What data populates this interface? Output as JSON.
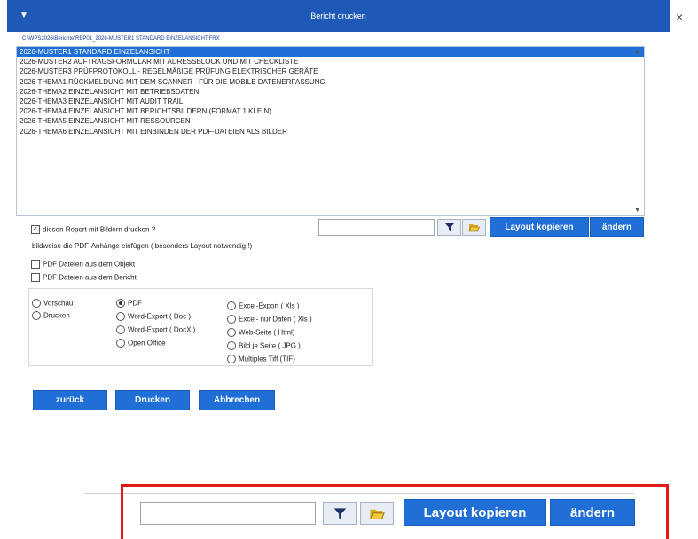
{
  "window": {
    "title": "Bericht drucken",
    "menu_icon": "filter-icon",
    "close_label": "×"
  },
  "path": "C:\\WPS2026\\Berichte\\REP01_2026-MUSTER1 STANDARD EINZELANSICHT.FRX",
  "reports": [
    {
      "label": "2026-MUSTER1 STANDARD EINZELANSICHT",
      "selected": true
    },
    {
      "label": "2026-MUSTER2 AUFTRAGSFORMULAR MIT ADRESSBLOCK UND MIT CHECKLISTE",
      "selected": false
    },
    {
      "label": "2026-MUSTER3 PRÜFPROTOKOLL - REGELMÄßIGE PRÜFUNG ELEKTRISCHER GERÄTE",
      "selected": false
    },
    {
      "label": "2026-THEMA1 RÜCKMELDUNG MIT DEM SCANNER - FÜR DIE MOBILE DATENERFASSUNG",
      "selected": false
    },
    {
      "label": "2026-THEMA2 EINZELANSICHT MIT BETRIEBSDATEN",
      "selected": false
    },
    {
      "label": "2026-THEMA3 EINZELANSICHT MIT AUDIT TRAIL",
      "selected": false
    },
    {
      "label": "2026-THEMA4 EINZELANSICHT MIT BERICHTSBILDERN (FORMAT 1 KLEIN)",
      "selected": false
    },
    {
      "label": "2026-THEMA5 EINZELANSICHT MIT RESSOURCEN",
      "selected": false
    },
    {
      "label": "2026-THEMA6 EINZELANSICHT MIT EINBINDEN DER PDF-DATEIEN ALS BILDER",
      "selected": false
    }
  ],
  "print_with_images": {
    "label": "diesen Report mit Bildern drucken ?",
    "checked": true
  },
  "toolbar": {
    "search_value": "",
    "filter_icon": "filter-icon",
    "folder_icon": "folder-open-icon",
    "copy_layout_label": "Layout kopieren",
    "change_label": "ändern"
  },
  "pdf_attach": {
    "hint": "bildweise die PDF-Anhänge einfügen ( besonders Layout notwendig !)",
    "from_object": {
      "label": "PDF Dateien aus dem Objekt",
      "checked": false
    },
    "from_report": {
      "label": "PDF Dateien aus dem Bericht",
      "checked": false
    }
  },
  "output_target": [
    {
      "label": "Vorschau",
      "selected": false
    },
    {
      "label": "Drucken",
      "selected": false
    }
  ],
  "formats_col1": [
    {
      "label": "PDF",
      "selected": true
    },
    {
      "label": "Word-Export ( Doc )",
      "selected": false
    },
    {
      "label": "Word-Export  ( DocX )",
      "selected": false
    },
    {
      "label": "Open Office",
      "selected": false
    }
  ],
  "formats_col2": [
    {
      "label": "Excel-Export ( Xls )",
      "selected": false
    },
    {
      "label": "Excel- nur Daten ( Xls )",
      "selected": false
    },
    {
      "label": "Web-Seite ( Html)",
      "selected": false
    },
    {
      "label": "Bild je Seite ( JPG )",
      "selected": false
    },
    {
      "label": "Multiples Tiff  (TIF)",
      "selected": false
    }
  ],
  "actions": {
    "back": "zurück",
    "print": "Drucken",
    "cancel": "Abbrechen"
  },
  "zoom_toolbar": {
    "search_value": "",
    "copy_layout_label": "Layout kopieren",
    "change_label": "ändern"
  },
  "colors": {
    "titlebar": "#1f59b8",
    "button": "#1f6fd6",
    "highlight_frame": "#e01818"
  }
}
